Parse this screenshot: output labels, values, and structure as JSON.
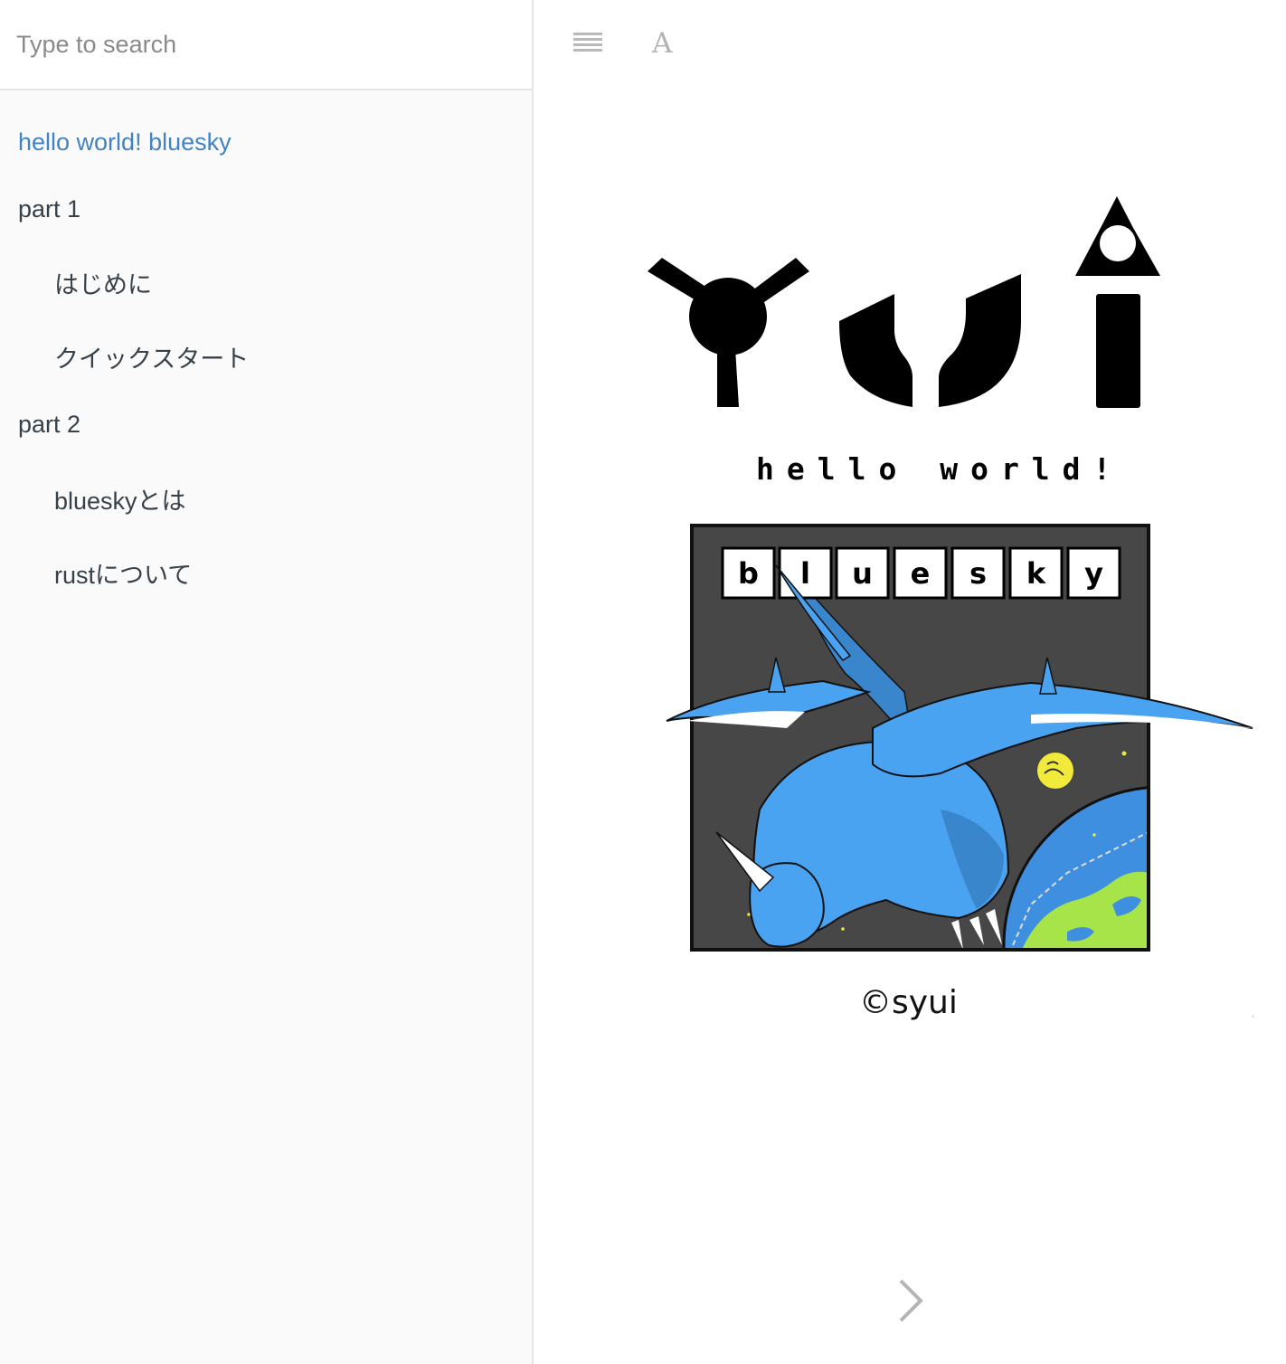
{
  "sidebar": {
    "search": {
      "placeholder": "Type to search",
      "value": ""
    },
    "toc": [
      {
        "label": "hello world! bluesky",
        "level": 0,
        "active": true
      },
      {
        "label": "part 1",
        "level": 0,
        "active": false
      },
      {
        "label": "はじめに",
        "level": 1,
        "active": false
      },
      {
        "label": "クイックスタート",
        "level": 1,
        "active": false
      },
      {
        "label": "part 2",
        "level": 0,
        "active": false
      },
      {
        "label": "blueskyとは",
        "level": 1,
        "active": false
      },
      {
        "label": "rustについて",
        "level": 1,
        "active": false
      }
    ]
  },
  "toolbar": {
    "menu_icon": "hamburger-menu-icon",
    "font_icon": "font-settings-icon",
    "font_glyph": "A"
  },
  "cover": {
    "logo_text": "yui",
    "tagline": "hello world!",
    "title_letters": [
      "b",
      "l",
      "u",
      "e",
      "s",
      "k",
      "y"
    ],
    "credit_symbol": "©",
    "credit_name": "syui"
  },
  "navigation": {
    "next_icon": "chevron-right-icon"
  },
  "colors": {
    "link_active": "#4183c4",
    "sidebar_bg": "#fafafa",
    "sidebar_text": "#364149",
    "cover_frame_bg": "#444444",
    "dragon_blue": "#4aa3f0",
    "earth_green": "#a6e44a"
  }
}
